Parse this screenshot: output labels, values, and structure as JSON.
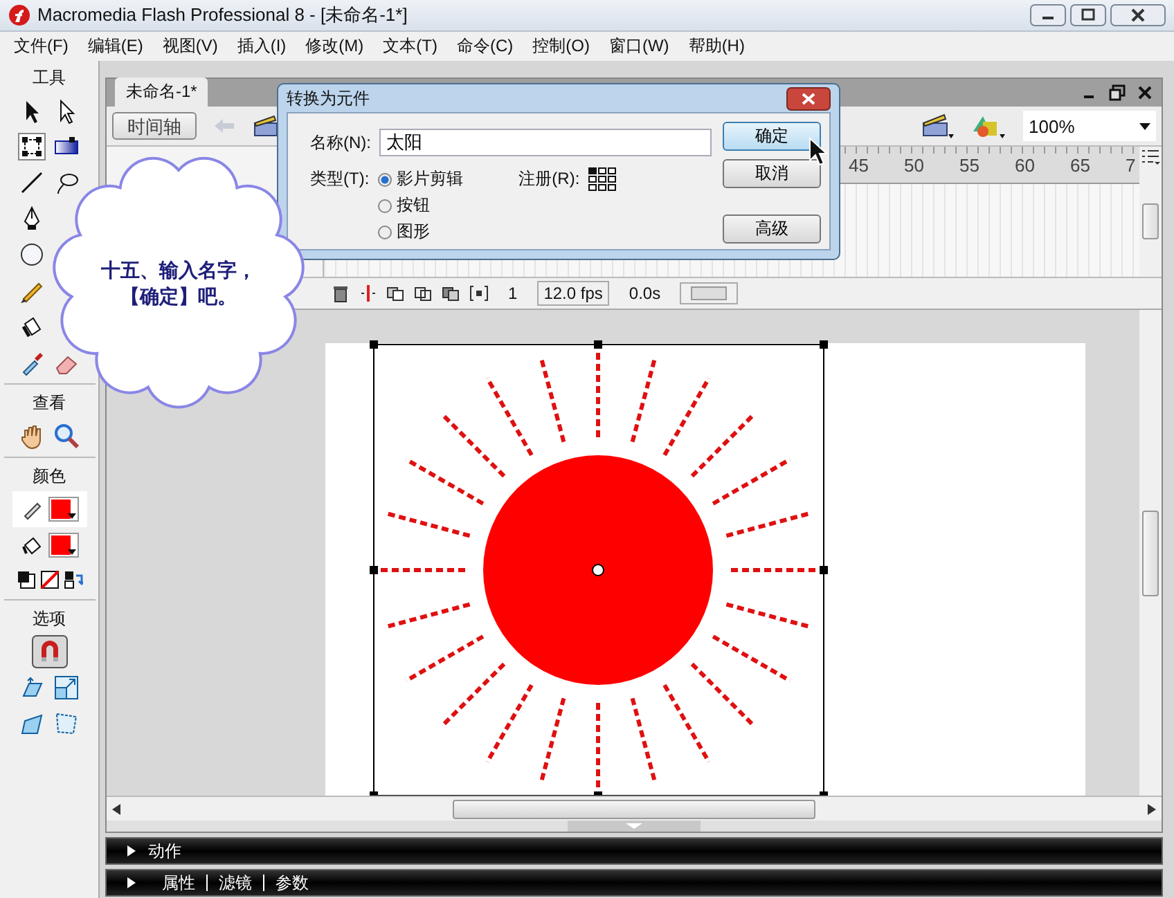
{
  "window": {
    "title": "Macromedia Flash Professional 8 - [未命名-1*]"
  },
  "menu": [
    "文件(F)",
    "编辑(E)",
    "视图(V)",
    "插入(I)",
    "修改(M)",
    "文本(T)",
    "命令(C)",
    "控制(O)",
    "窗口(W)",
    "帮助(H)"
  ],
  "tools": {
    "title": "工具",
    "view_label": "查看",
    "color_label": "颜色",
    "color_controls": [
      {
        "kind": "stroke",
        "color": "#ff0000"
      },
      {
        "kind": "fill",
        "color": "#ff0000"
      }
    ],
    "options_label": "选项",
    "snap": {
      "on": true
    }
  },
  "document": {
    "tab": "未命名-1*",
    "timeline_button": "时间轴",
    "zoom": "100%",
    "ruler_labels": [
      "45",
      "50",
      "55",
      "60",
      "65",
      "7"
    ],
    "current_frame": "1",
    "frame_rate": "12.0 fps",
    "elapsed": "0.0s"
  },
  "dialog": {
    "title": "转换为元件",
    "name_label": "名称(N):",
    "name_value": "太阳",
    "type_label": "类型(T):",
    "types": [
      {
        "label": "影片剪辑",
        "selected": true
      },
      {
        "label": "按钮",
        "selected": false
      },
      {
        "label": "图形",
        "selected": false
      }
    ],
    "register_label": "注册(R):",
    "buttons": [
      {
        "label": "确定",
        "focused": true
      },
      {
        "label": "取消",
        "focused": false
      },
      {
        "label": "高级",
        "focused": false
      }
    ]
  },
  "callout": {
    "lines": [
      "十五、输入名字，",
      "【确定】吧。"
    ]
  },
  "panels": [
    {
      "tabs": [
        "动作"
      ]
    },
    {
      "tabs": [
        "属性",
        "滤镜",
        "参数"
      ]
    }
  ]
}
